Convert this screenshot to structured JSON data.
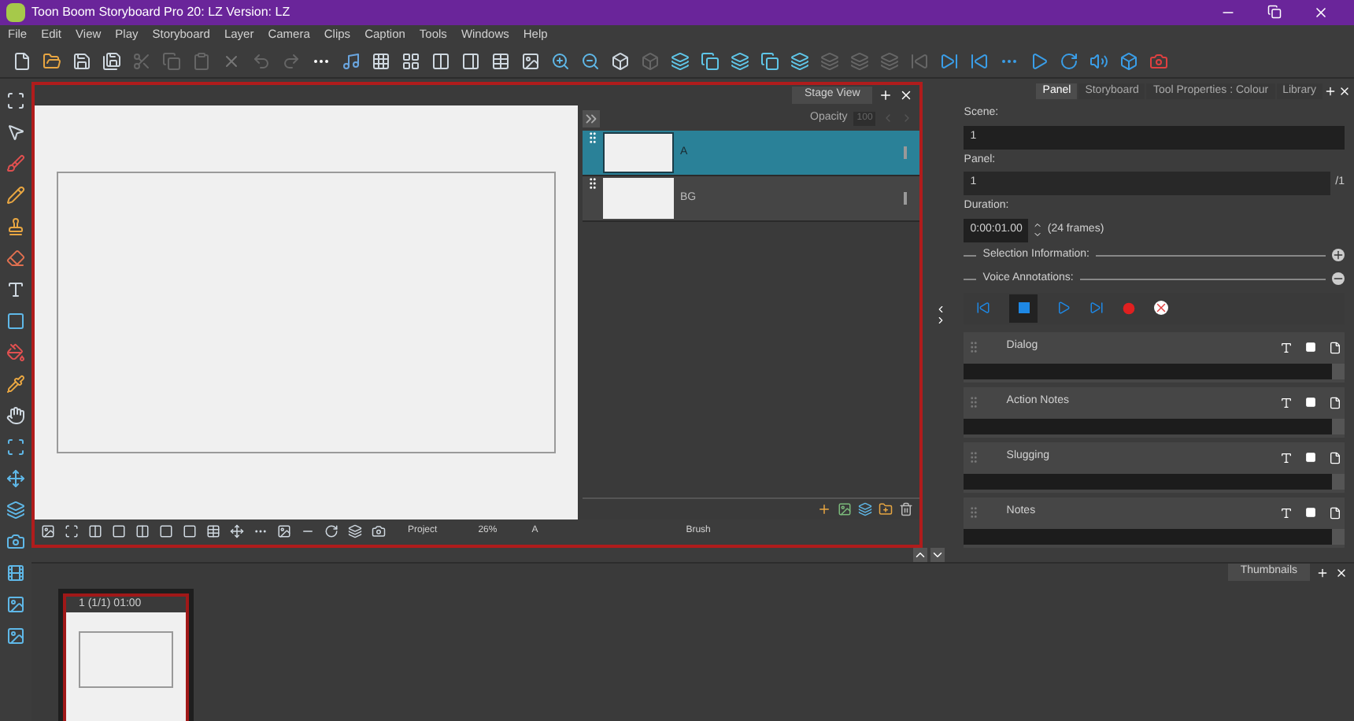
{
  "window": {
    "title": "Toon Boom Storyboard Pro 20: LZ Version: LZ"
  },
  "menu": [
    "File",
    "Edit",
    "View",
    "Play",
    "Storyboard",
    "Layer",
    "Camera",
    "Clips",
    "Caption",
    "Tools",
    "Windows",
    "Help"
  ],
  "stage_view": {
    "tab": "Stage View",
    "opacity_label": "Opacity",
    "opacity_value": "100",
    "layers": [
      {
        "name": "A",
        "selected": true
      },
      {
        "name": "BG",
        "selected": false
      }
    ],
    "status": {
      "project": "Project",
      "zoom": "26%",
      "layer": "A",
      "tool": "Brush"
    }
  },
  "right_panel": {
    "tabs": [
      {
        "label": "Panel",
        "selected": true
      },
      {
        "label": "Storyboard",
        "selected": false
      },
      {
        "label": "Tool Properties : Colour",
        "selected": false
      },
      {
        "label": "Library",
        "selected": false
      }
    ],
    "scene_label": "Scene:",
    "scene": "1",
    "panel_label": "Panel:",
    "panel": "1",
    "panel_total": "/1",
    "duration_label": "Duration:",
    "duration": "0:00:01.00",
    "frames": "(24 frames)",
    "sections": [
      "Selection Information:",
      "Voice Annotations:"
    ],
    "captions": [
      "Dialog",
      "Action Notes",
      "Slugging",
      "Notes"
    ]
  },
  "thumbnails": {
    "tab": "Thumbnails",
    "items": [
      {
        "label": "1 (1/1) 01:00",
        "selected": true
      }
    ]
  }
}
